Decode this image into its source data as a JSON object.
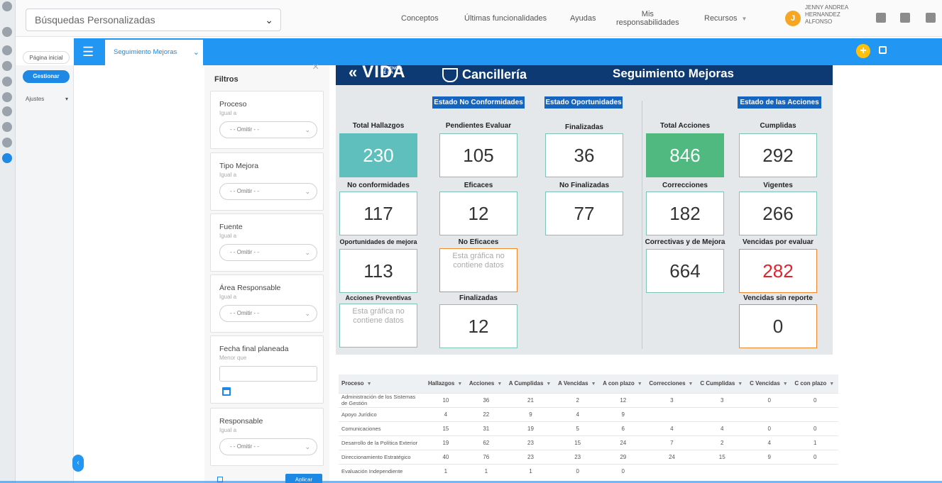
{
  "topbar": {
    "search_select": "Búsquedas Personalizadas",
    "nav": [
      "Conceptos",
      "Últimas funcionalidades",
      "Ayudas",
      "Mis responsabilidades",
      "Recursos"
    ],
    "user_initial": "J",
    "user_name": "JENNY ANDREA HERNANDEZ ALFONSO"
  },
  "secbar": {
    "tab_label": "Seguimiento Mejoras"
  },
  "sidebar": {
    "home": "Página inicial",
    "manage": "Gestionar",
    "settings": "Ajustes"
  },
  "filters": {
    "title": "Filtros",
    "items": [
      {
        "label": "Proceso",
        "sub": "Igual a",
        "value": "- - Omitir - -"
      },
      {
        "label": "Tipo Mejora",
        "sub": "Igual a",
        "value": "- - Omitir - -"
      },
      {
        "label": "Fuente",
        "sub": "Igual a",
        "value": "- - Omitir - -"
      },
      {
        "label": "Área Responsable",
        "sub": "Igual a",
        "value": "- - Omitir - -"
      },
      {
        "label": "Fecha final planeada",
        "sub": "Menor que",
        "value": ""
      },
      {
        "label": "Responsable",
        "sub": "Igual a",
        "value": "- - Omitir - -"
      }
    ],
    "apply": "Aplicar"
  },
  "dashboard": {
    "logo_vida_small": "POTENCIA DE LA",
    "logo_vida": "VIDA",
    "logo_cancilleria": "Cancillería",
    "title": "Seguimiento Mejoras",
    "badges": {
      "no_conformidades": "Estado No Conformidades",
      "oportunidades": "Estado Oportunidades",
      "acciones": "Estado de las Acciones"
    },
    "kpis": {
      "total_hallazgos": {
        "label": "Total Hallazgos",
        "value": "230"
      },
      "pendientes_evaluar": {
        "label": "Pendientes Evaluar",
        "value": "105"
      },
      "finalizadas_op": {
        "label": "Finalizadas",
        "value": "36"
      },
      "total_acciones": {
        "label": "Total Acciones",
        "value": "846"
      },
      "cumplidas": {
        "label": "Cumplidas",
        "value": "292"
      },
      "no_conformidades": {
        "label": "No conformidades",
        "value": "117"
      },
      "eficaces": {
        "label": "Eficaces",
        "value": "12"
      },
      "no_finalizadas": {
        "label": "No Finalizadas",
        "value": "77"
      },
      "correcciones": {
        "label": "Correcciones",
        "value": "182"
      },
      "vigentes": {
        "label": "Vigentes",
        "value": "266"
      },
      "oportunidades_mejora": {
        "label": "Oportunidades de mejora",
        "value": "113"
      },
      "no_eficaces": {
        "label": "No Eficaces",
        "value": "Esta gráfica no contiene datos"
      },
      "correctivas_mejora": {
        "label": "Correctivas y de Mejora",
        "value": "664"
      },
      "vencidas_evaluar": {
        "label": "Vencidas por evaluar",
        "value": "282"
      },
      "acciones_preventivas": {
        "label": "Acciones Preventivas",
        "value": "Esta gráfica no contiene datos"
      },
      "finalizadas_nc": {
        "label": "Finalizadas",
        "value": "12"
      },
      "vencidas_sin_reporte": {
        "label": "Vencidas sin reporte",
        "value": "0"
      }
    }
  },
  "table": {
    "headers": [
      "Proceso",
      "Hallazgos",
      "Acciones",
      "A Cumplidas",
      "A Vencidas",
      "A con plazo",
      "Correcciones",
      "C Cumplidas",
      "C Vencidas",
      "C con plazo"
    ],
    "rows": [
      [
        "Administración de los Sistemas de Gestión",
        "10",
        "36",
        "21",
        "2",
        "12",
        "3",
        "3",
        "0",
        "0"
      ],
      [
        "Apoyo Jurídico",
        "4",
        "22",
        "9",
        "4",
        "9",
        "",
        "",
        "",
        ""
      ],
      [
        "Comunicaciones",
        "15",
        "31",
        "19",
        "5",
        "6",
        "4",
        "4",
        "0",
        "0"
      ],
      [
        "Desarrollo de la Política Exterior",
        "19",
        "62",
        "23",
        "15",
        "24",
        "7",
        "2",
        "4",
        "1"
      ],
      [
        "Direccionamiento Estratégico",
        "40",
        "76",
        "23",
        "23",
        "29",
        "24",
        "15",
        "9",
        "0"
      ],
      [
        "Evaluación Independiente",
        "1",
        "1",
        "1",
        "0",
        "0",
        "",
        "",
        "",
        ""
      ]
    ]
  }
}
